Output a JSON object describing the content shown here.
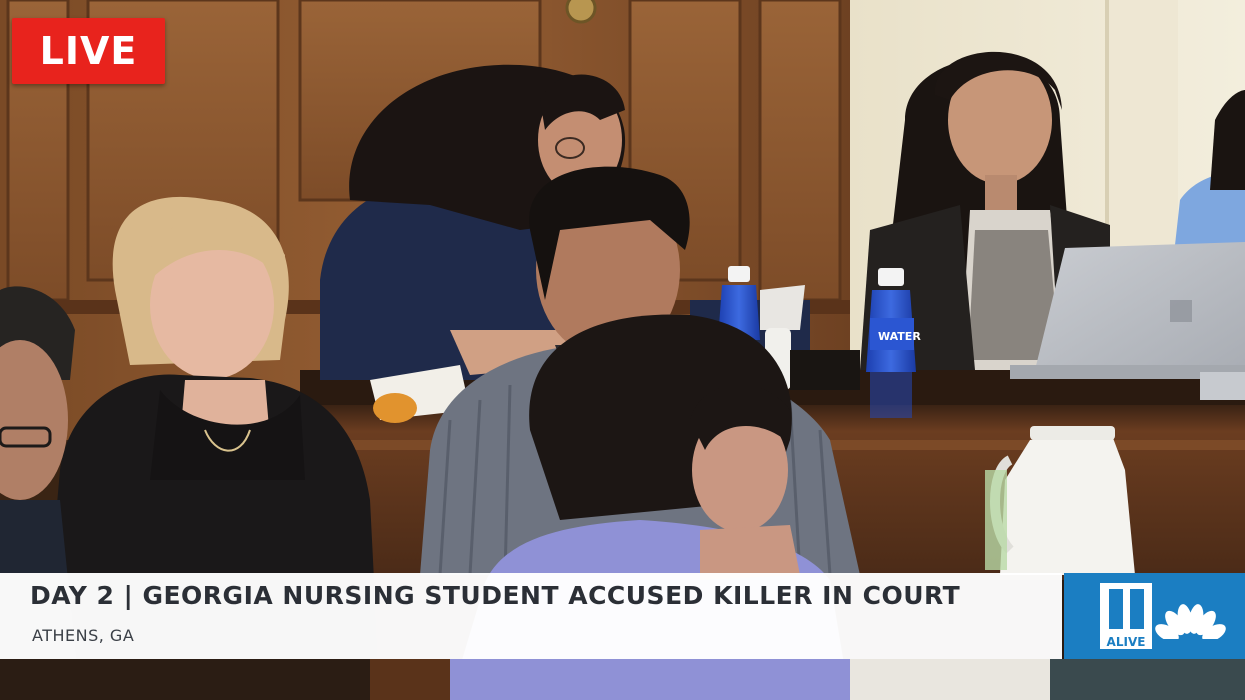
{
  "video": {
    "live_label": "LIVE",
    "headline": "DAY 2 | GEORGIA NURSING STUDENT ACCUSED KILLER IN COURT",
    "location": "ATHENS, GA",
    "station_logo_text": "ALIVE",
    "bottle_label": "WATER"
  },
  "colors": {
    "live_red": "#e8231d",
    "logo_blue": "#1b7ec2",
    "headline_text": "#2b2f36"
  }
}
